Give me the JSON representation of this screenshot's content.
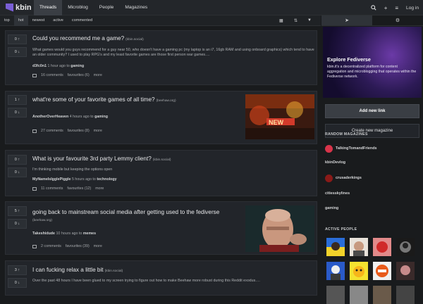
{
  "app": {
    "name": "kbin"
  },
  "nav": [
    "Threads",
    "Microblog",
    "People",
    "Magazines"
  ],
  "tools": {
    "search": "search-icon",
    "add": "+",
    "menu": "≡",
    "login": "Log in"
  },
  "sort_tabs": [
    "top",
    "hot",
    "newest",
    "active",
    "commented"
  ],
  "posts": [
    {
      "up": "0 ↑",
      "down": "0 ↓",
      "title": "Could you recommend me a game?",
      "domain": "(kbin.social)",
      "body": "What games would you guys recommend for a guy near 50, who doesn't have a gaming pc (my laptop is an i7, 16gb RAM and using onboard graphics) which tend to have an older community? I used to play RPG's and my least favorite games are those first person war games.…",
      "author": "d3fc0n1",
      "time": "1 hour ago",
      "to": "to",
      "magazine": "gaming",
      "comments": "16 comments",
      "favs": "favourites (6)",
      "more": "more"
    },
    {
      "up": "1 ↑",
      "down": "0 ↓",
      "title": "what're some of your favorite games of all time?",
      "domain": "(beehaw.org)",
      "author": "AnotherOverHeaven",
      "time": "4 hours ago",
      "to": "to",
      "magazine": "gaming",
      "comments": "27 comments",
      "favs": "favourites (8)",
      "more": "more"
    },
    {
      "up": "0 ↑",
      "down": "0 ↓",
      "title": "What is your favourite 3rd party Lemmy client?",
      "domain": "(kbin.social)",
      "body": "I'm thinking mobile but keeping the options open",
      "author": "MyNameIsIgglePiggle",
      "time": "5 hours ago",
      "to": "to",
      "magazine": "technology",
      "comments": "11 comments",
      "favs": "favourites (12)",
      "more": "more"
    },
    {
      "up": "5 ↑",
      "down": "0 ↓",
      "title": "going back to mainstream social media after getting used to the fediverse",
      "domain": "(beehaw.org)",
      "author": "Takeshidude",
      "time": "10 hours ago",
      "to": "to",
      "magazine": "memes",
      "comments": "2 comments",
      "favs": "favourites (39)",
      "more": "more"
    },
    {
      "up": "3 ↑",
      "down": "0 ↓",
      "title": "I can fucking relax a little bit",
      "domain": "(kbin.social)",
      "body": "Over the past 48 hours I have been glued to my screen trying to figure out how to make Beehaw more robust during this Reddit exodus.…"
    }
  ],
  "sidebar": {
    "hero_title": "Explore Fediverse",
    "hero_desc": "kbin.it's a decentralized platform for content aggregation and microblogging that operates within the Fediverse network.",
    "add_link": "Add new link",
    "new_magazine": "Create new magazine",
    "random_heading": "RANDOM MAGAZINES",
    "magazines": [
      "TalkingTomandFriends",
      "kbinDevlog",
      "crusaderkings",
      "citiesskylines",
      "gaming"
    ],
    "people_heading": "ACTIVE PEOPLE"
  },
  "colors": {
    "accent": "#7a5fd6",
    "bg": "#191b1d",
    "card": "#22252a"
  }
}
